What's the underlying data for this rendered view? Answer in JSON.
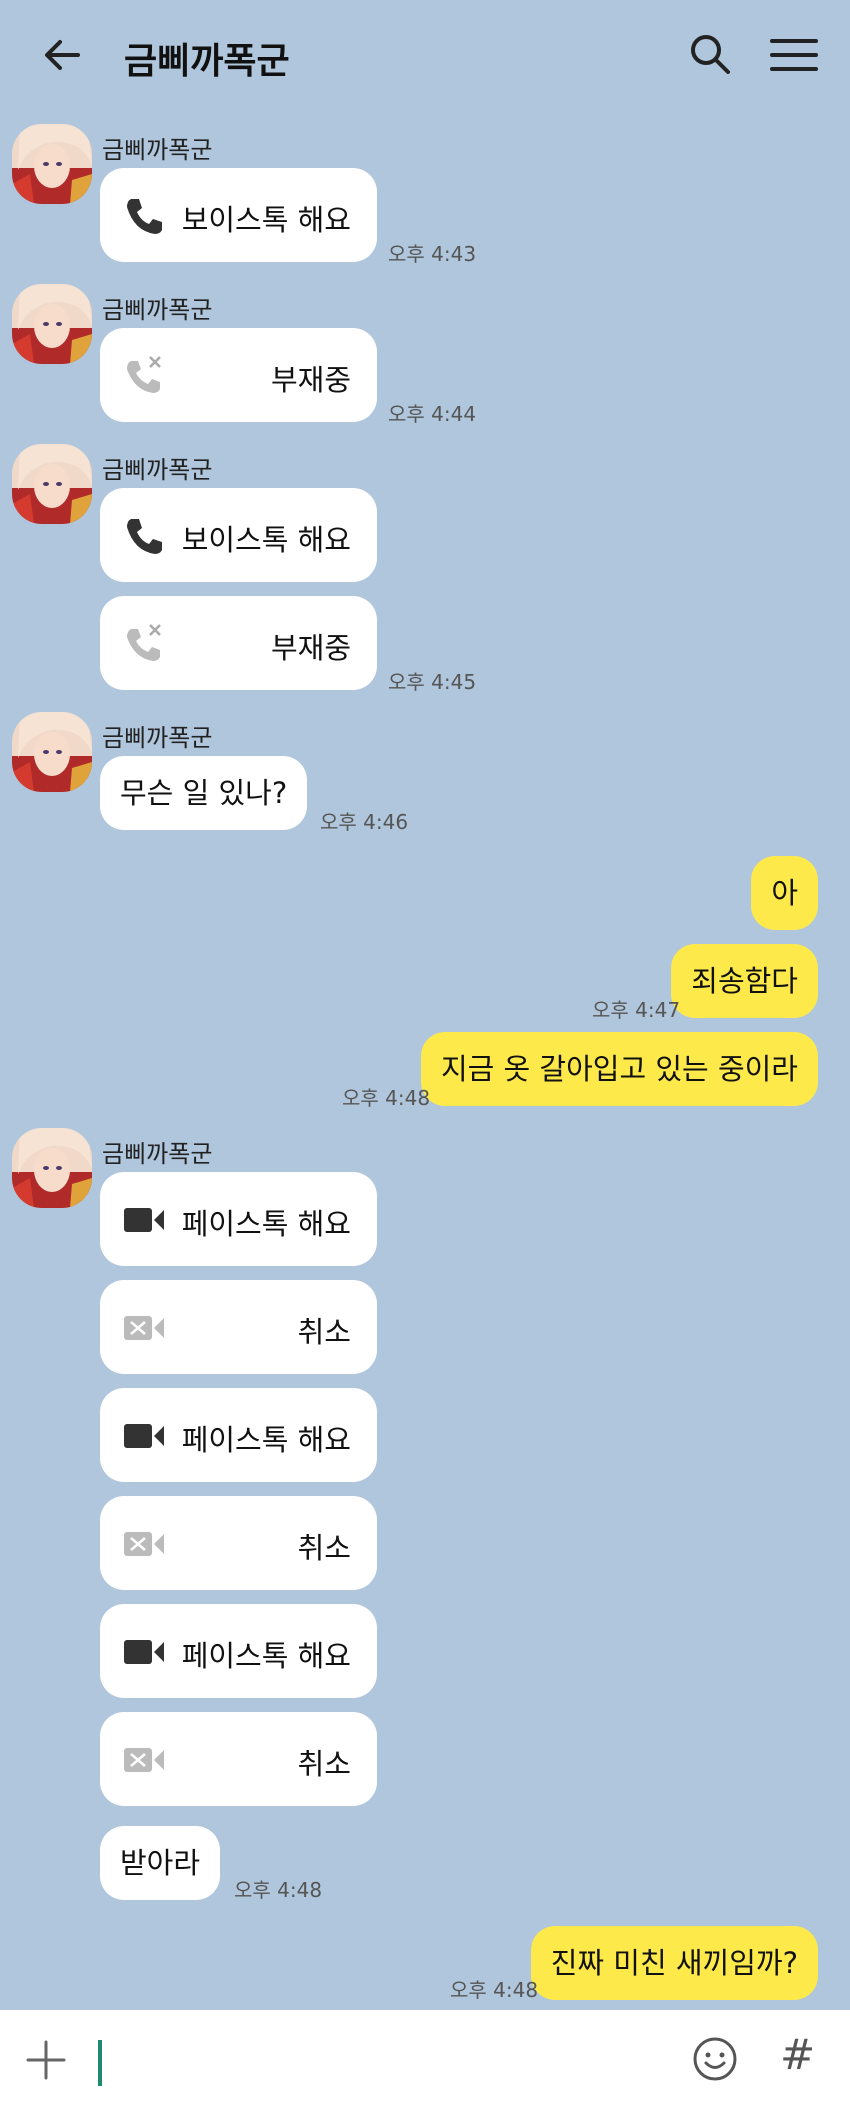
{
  "header": {
    "title": "금삐까폭군",
    "back_icon": "arrow-left-icon",
    "search_icon": "search-icon",
    "menu_icon": "hamburger-menu-icon"
  },
  "chat": {
    "groups": [
      {
        "sender": "금삐까폭군",
        "messages": [
          {
            "type": "call",
            "icon": "phone-icon",
            "label": "보이스톡 해요"
          }
        ],
        "time": "오후 4:43"
      },
      {
        "sender": "금삐까폭군",
        "messages": [
          {
            "type": "call",
            "icon": "missed-call-icon",
            "label": "부재중"
          }
        ],
        "time": "오후 4:44"
      },
      {
        "sender": "금삐까폭군",
        "messages": [
          {
            "type": "call",
            "icon": "phone-icon",
            "label": "보이스톡 해요"
          },
          {
            "type": "call",
            "icon": "missed-call-icon",
            "label": "부재중"
          }
        ],
        "time": "오후 4:45"
      },
      {
        "sender": "금삐까폭군",
        "messages": [
          {
            "type": "text",
            "text": "무슨 일 있나?"
          }
        ],
        "time": "오후 4:46"
      },
      {
        "sender": "me",
        "messages": [
          {
            "type": "text",
            "text": "아"
          },
          {
            "type": "text",
            "text": "죄송함다",
            "time": "오후 4:47"
          },
          {
            "type": "text",
            "text": "지금 옷 갈아입고 있는 중이라",
            "time": "오후 4:48"
          }
        ]
      },
      {
        "sender": "금삐까폭군",
        "messages": [
          {
            "type": "call",
            "icon": "video-call-icon",
            "label": "페이스톡 해요"
          },
          {
            "type": "call",
            "icon": "video-cancel-icon",
            "label": "취소"
          },
          {
            "type": "call",
            "icon": "video-call-icon",
            "label": "페이스톡 해요"
          },
          {
            "type": "call",
            "icon": "video-cancel-icon",
            "label": "취소"
          },
          {
            "type": "call",
            "icon": "video-call-icon",
            "label": "페이스톡 해요"
          },
          {
            "type": "call",
            "icon": "video-cancel-icon",
            "label": "취소"
          },
          {
            "type": "text",
            "text": "받아라"
          }
        ],
        "time": "오후 4:48"
      },
      {
        "sender": "me",
        "messages": [
          {
            "type": "text",
            "text": "진짜 미친 새끼임까?"
          }
        ],
        "time": "오후 4:48"
      }
    ]
  },
  "input_bar": {
    "plus_icon": "plus-icon",
    "emoji_icon": "emoji-icon",
    "hash_label": "#"
  },
  "colors": {
    "background": "#b0c6dc",
    "my_bubble": "#fde94a",
    "their_bubble": "#ffffff",
    "caret": "#1f8a70"
  }
}
